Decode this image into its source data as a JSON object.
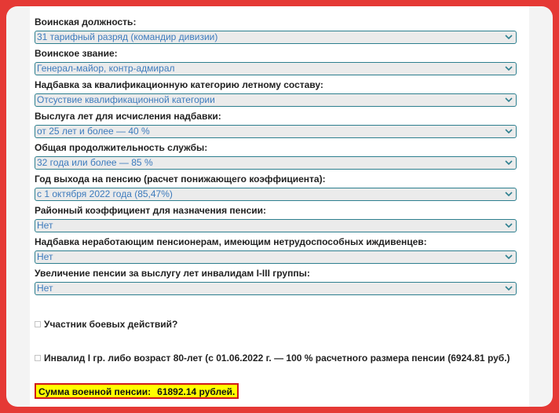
{
  "fields": [
    {
      "label": "Воинская должность:",
      "value": "31 тарифный разряд (командир дивизии)"
    },
    {
      "label": "Воинское звание:",
      "value": "Генерал-майор, контр-адмирал"
    },
    {
      "label": "Надбавка за квалификационную категорию летному составу:",
      "value": "Отсуствие квалификационной категории"
    },
    {
      "label": "Выслуга лет для исчисления надбавки:",
      "value": "от 25 лет и более — 40 %"
    },
    {
      "label": "Общая продолжительность службы:",
      "value": "32 года или более — 85 %"
    },
    {
      "label": "Год выхода на пенсию (расчет понижающего коэффициента):",
      "value": "с 1 октября 2022 года (85,47%)"
    },
    {
      "label": "Районный коэффициент для назначения пенсии:",
      "value": "Нет"
    },
    {
      "label": "Надбавка неработающим пенсионерам, имеющим нетрудоспособных иждивенцев:",
      "value": "Нет"
    },
    {
      "label": "Увеличение пенсии за выслугу лет инвалидам I-III группы:",
      "value": "Нет"
    }
  ],
  "checkboxes": {
    "combat_veteran": {
      "label": "Участник боевых действий?",
      "checked": false
    },
    "disabled_or_80": {
      "label": "Инвалид I гр. либо возраст 80-лет (с 01.06.2022 г. — 100 % расчетного размера пенсии (6924.81 руб.)",
      "checked": false
    }
  },
  "result": {
    "label": "Сумма военной пенсии:",
    "value": "61892.14 рублей."
  },
  "colors": {
    "outer_border": "#e53935",
    "select_border": "#2d7f8f",
    "select_text": "#3d7bbd",
    "result_highlight": "#ffff00",
    "result_border": "#d01818"
  },
  "icons": {
    "select_arrow": "chevron-down-icon"
  }
}
